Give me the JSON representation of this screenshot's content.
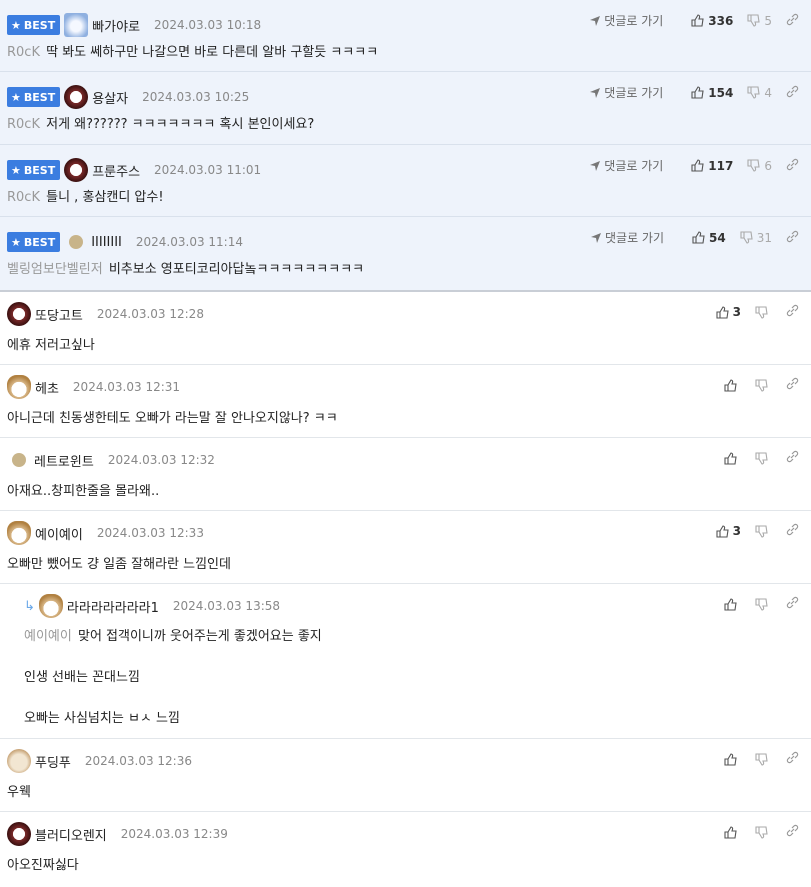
{
  "ui": {
    "best_label": "BEST",
    "goto_label": "댓글로 가기"
  },
  "comments": [
    {
      "best": true,
      "nick": "빠가야로",
      "date": "2024.03.03 10:18",
      "ref": "R0cK",
      "text": "딱 봐도 쎄하구만 나갈으면 바로 다른데 알바 구할듯 ㅋㅋㅋㅋ",
      "up": "336",
      "down": "5"
    },
    {
      "best": true,
      "nick": "용살자",
      "date": "2024.03.03 10:25",
      "ref": "R0cK",
      "text": "저게 왜?????? ㅋㅋㅋㅋㅋㅋㅋ 혹시 본인이세요?",
      "up": "154",
      "down": "4"
    },
    {
      "best": true,
      "nick": "프룬주스",
      "date": "2024.03.03 11:01",
      "ref": "R0cK",
      "text": "틀니 , 홍삼캔디 압수!",
      "up": "117",
      "down": "6"
    },
    {
      "best": true,
      "nick": "IIIIIIII",
      "date": "2024.03.03 11:14",
      "ref": "벨링엄보단벨린저",
      "text": "비추보소 영포티코리아답놐ㅋㅋㅋㅋㅋㅋㅋㅋㅋ",
      "up": "54",
      "down": "31"
    },
    {
      "best": false,
      "nick": "또당고트",
      "date": "2024.03.03 12:28",
      "text": "에휴 저러고싶나",
      "up": "3"
    },
    {
      "best": false,
      "nick": "헤초",
      "date": "2024.03.03 12:31",
      "text": "아니근데 친동생한테도 오빠가 라는말 잘 안나오지않나? ㅋㅋ",
      "up": ""
    },
    {
      "best": false,
      "nick": "레트로윈트",
      "date": "2024.03.03 12:32",
      "text": "아재요..창피한줄을 몰라왜..",
      "up": ""
    },
    {
      "best": false,
      "nick": "예이예이",
      "date": "2024.03.03 12:33",
      "text": "오빠만 뺐어도 걍 일좀 잘해라란 느낌인데",
      "up": "3"
    },
    {
      "best": false,
      "reply": true,
      "nick": "라라라라라라라1",
      "date": "2024.03.03 13:58",
      "ref": "예이예이",
      "text": "맞어 접객이니까 웃어주는게 좋겠어요는 좋지",
      "text2": "인생 선배는 꼰대느낌",
      "text3": "오빠는 사심넘치는 ㅂㅅ 느낌",
      "up": ""
    },
    {
      "best": false,
      "nick": "푸딩푸",
      "date": "2024.03.03 12:36",
      "text": "우웩",
      "up": ""
    },
    {
      "best": false,
      "nick": "블러디오렌지",
      "date": "2024.03.03 12:39",
      "text": "아오진짜싫다",
      "up": ""
    }
  ]
}
